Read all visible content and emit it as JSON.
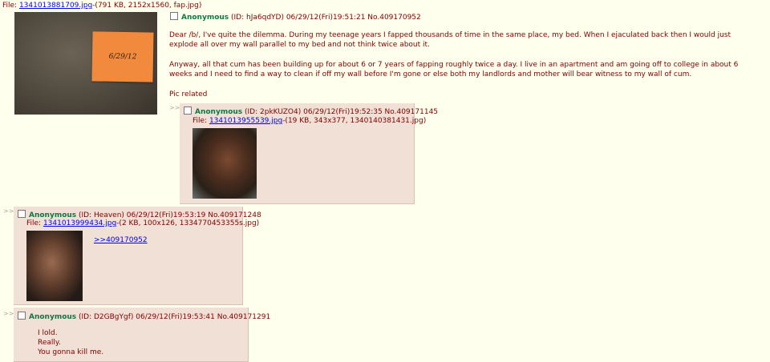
{
  "op": {
    "file_prefix": "File: ",
    "file_link": "1341013881709.jpg",
    "file_info": "-(791 KB, 2152x1560, fap.jpg)",
    "thumb_note_text": "6/29/12",
    "name": "Anonymous",
    "meta": " (ID: hJa6qdYD) 06/29/12(Fri)19:51:21 No.409170952",
    "body": [
      "Dear /b/, I've quite the dilemma. During my teenage years I fapped thousands of time in the same place, my bed. When I ejaculated back then I would just explode all over my wall parallel to my bed and not think twice about it.",
      "Anyway, all that cum has been building up for about 6 or 7 years of fapping roughly twice a day. I live in an apartment and am going off to college in about 6 weeks and I need to find a way to clean if off my wall before I'm gone or else both my landlords and mother will bear witness to my wall of cum.",
      "Pic related"
    ]
  },
  "replies": [
    {
      "arrows": ">>",
      "name": "Anonymous",
      "meta": " (ID: 2pkKUZO4) 06/29/12(Fri)19:52:35 No.409171145",
      "file_prefix": "File: ",
      "file_link": "1341013955539.jpg",
      "file_info": "-(19 KB, 343x377, 1340140381431.jpg)"
    },
    {
      "arrows": ">>",
      "name": "Anonymous",
      "meta": " (ID: Heaven) 06/29/12(Fri)19:53:19 No.409171248",
      "file_prefix": "File: ",
      "file_link": "1341013999434.jpg",
      "file_info": "-(2 KB, 100x126, 1334770453355s.jpg)",
      "quote": ">>409170952"
    },
    {
      "arrows": ">>",
      "name": "Anonymous",
      "meta": " (ID: D2GBgYgf) 06/29/12(Fri)19:53:41 No.409171291",
      "lines": [
        "I lold.",
        "Really.",
        "You gonna kill me."
      ]
    }
  ]
}
